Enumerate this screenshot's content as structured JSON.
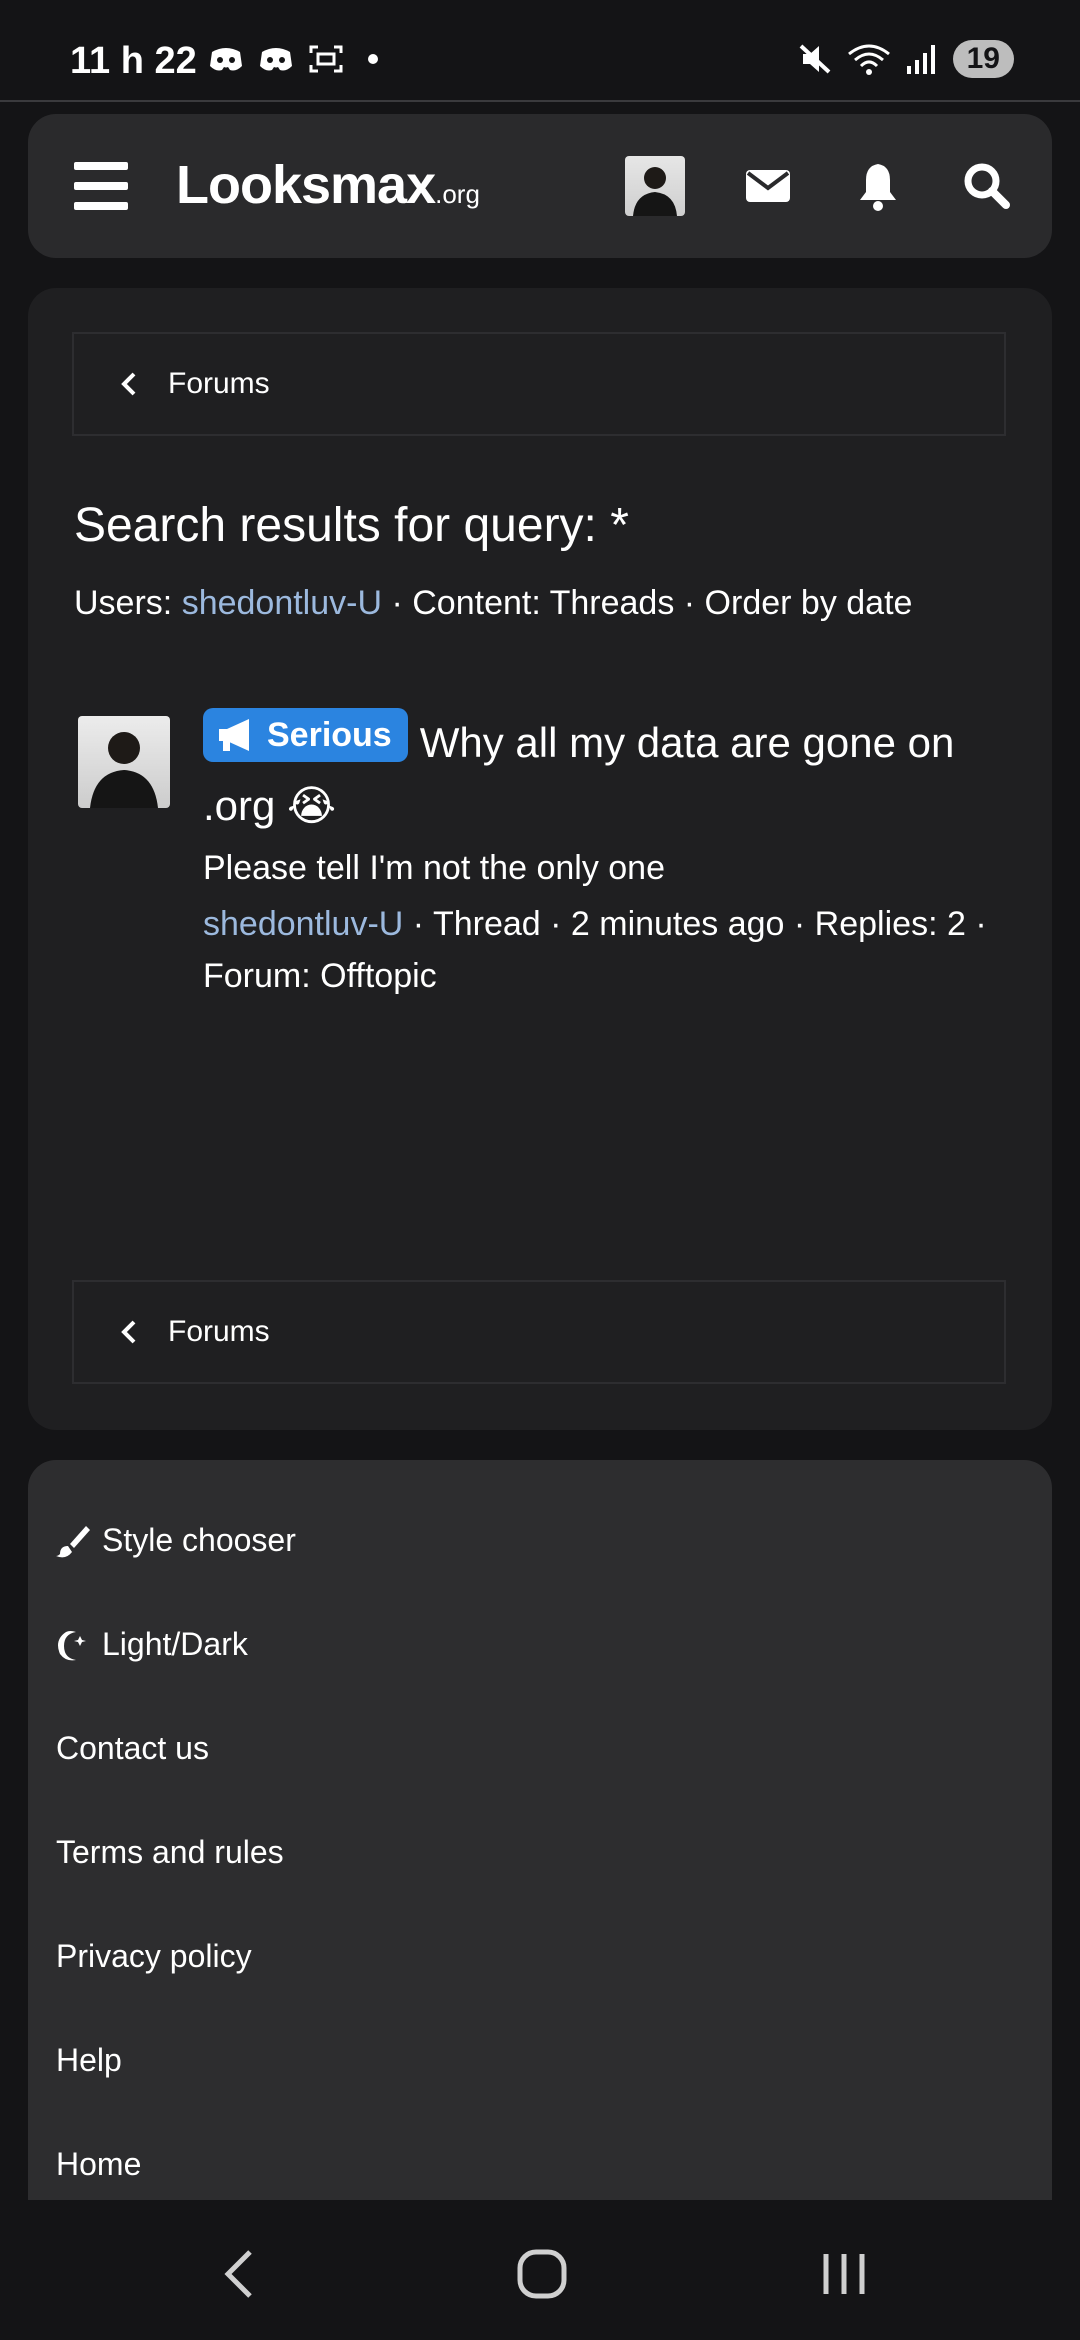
{
  "status_bar": {
    "time": "11 h 22",
    "battery": "19"
  },
  "header": {
    "logo_main": "Looksmax",
    "logo_suffix": ".org"
  },
  "breadcrumb": {
    "label": "Forums"
  },
  "search": {
    "title": "Search results for query: *",
    "users_label": "Users: ",
    "user": "shedontluv-U",
    "filters_rest": " · Content: Threads · Order by date"
  },
  "result": {
    "prefix_badge": "Serious",
    "title": "Why all my data are gone on .org 😭",
    "snippet": "Please tell I'm not the only one",
    "author": "shedontluv-U",
    "meta": " · Thread · 2 minutes ago · Replies: 2 · Forum: Offtopic"
  },
  "footer": {
    "style_chooser": "Style chooser",
    "light_dark": "Light/Dark",
    "contact": "Contact us",
    "terms": "Terms and rules",
    "privacy": "Privacy policy",
    "help": "Help",
    "home": "Home"
  },
  "colors": {
    "accent_badge": "#2b84e0",
    "link": "#9cb9de",
    "background": "#141416"
  }
}
